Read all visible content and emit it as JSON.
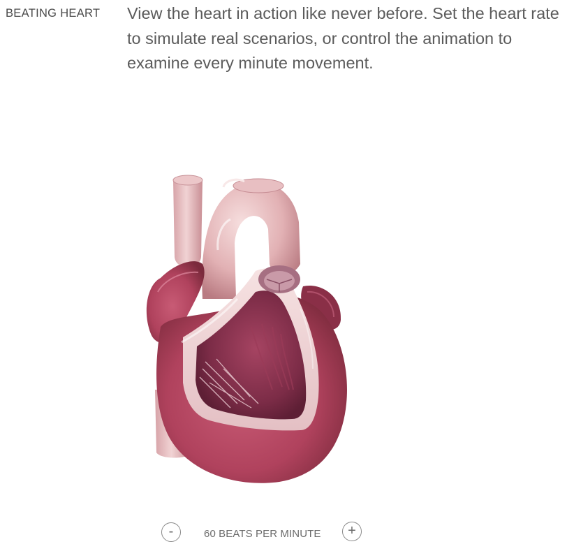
{
  "section": {
    "label": "BEATING HEART",
    "description": "View the heart in action like never before. Set the heart rate to simulate real scenarios, or control the animation to examine every minute movement."
  },
  "animation": {
    "image_alt": "Cutaway 3D heart model",
    "colors": {
      "muscle": "#b44560",
      "muscle_dark": "#7e2a3e",
      "vessel": "#e3b3b7",
      "vessel_highlight": "#f4d9da",
      "chamber": "#8c3450",
      "cut_edge": "#f2dcdc"
    }
  },
  "controls": {
    "decrease_label": "-",
    "increase_label": "+",
    "rate_text": "60 BEATS PER MINUTE",
    "beats_per_minute": 60
  }
}
